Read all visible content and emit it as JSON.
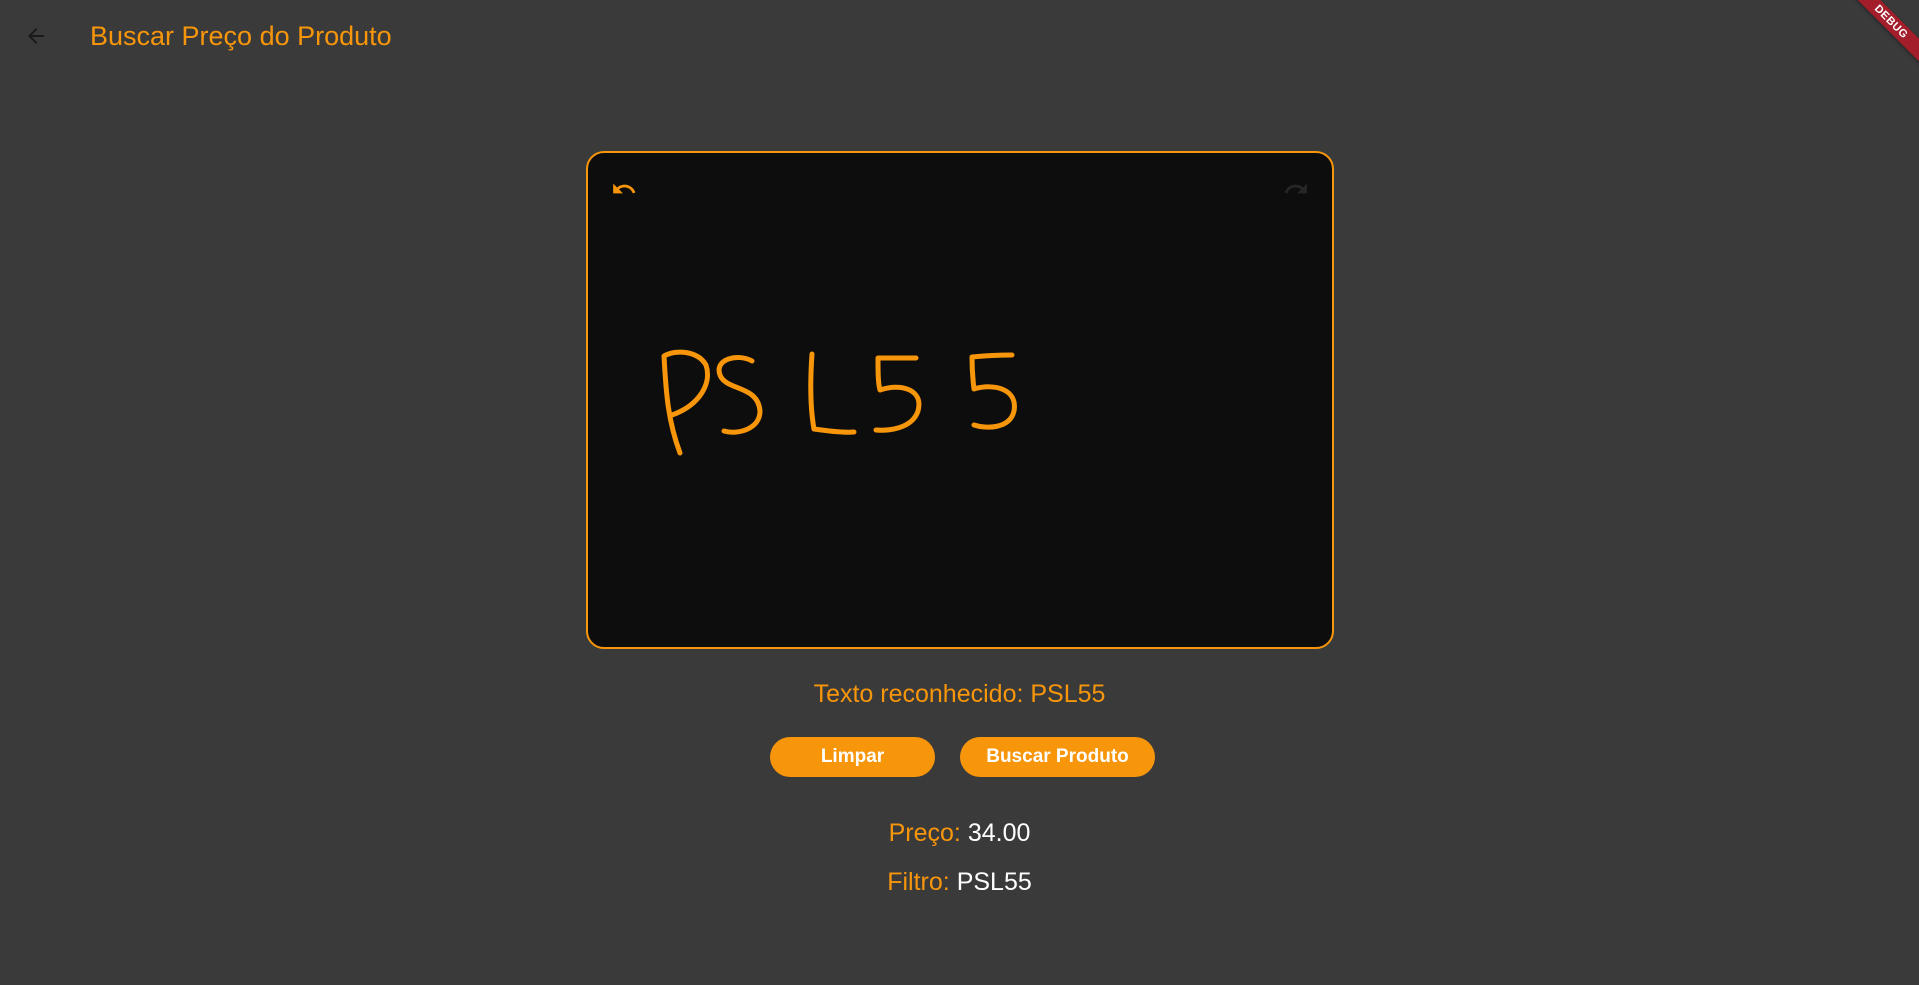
{
  "appbar": {
    "title": "Buscar Preço do Produto",
    "back_icon": "arrow-left-icon"
  },
  "debug_banner": "DEBUG",
  "canvas": {
    "undo_icon": "undo-icon",
    "redo_icon": "redo-icon",
    "handwritten_text": "PSL55",
    "stroke_color": "#f7960b"
  },
  "recognized": {
    "text": "Texto reconhecido: PSL55"
  },
  "buttons": {
    "clear_label": "Limpar",
    "search_label": "Buscar Produto"
  },
  "result": {
    "price_label": "Preço:",
    "price_value": "34.00",
    "filter_label": "Filtro:",
    "filter_value": "PSL55"
  },
  "colors": {
    "accent": "#f7960b",
    "background": "#3a3a3a",
    "canvas_bg": "#0e0d0e"
  }
}
